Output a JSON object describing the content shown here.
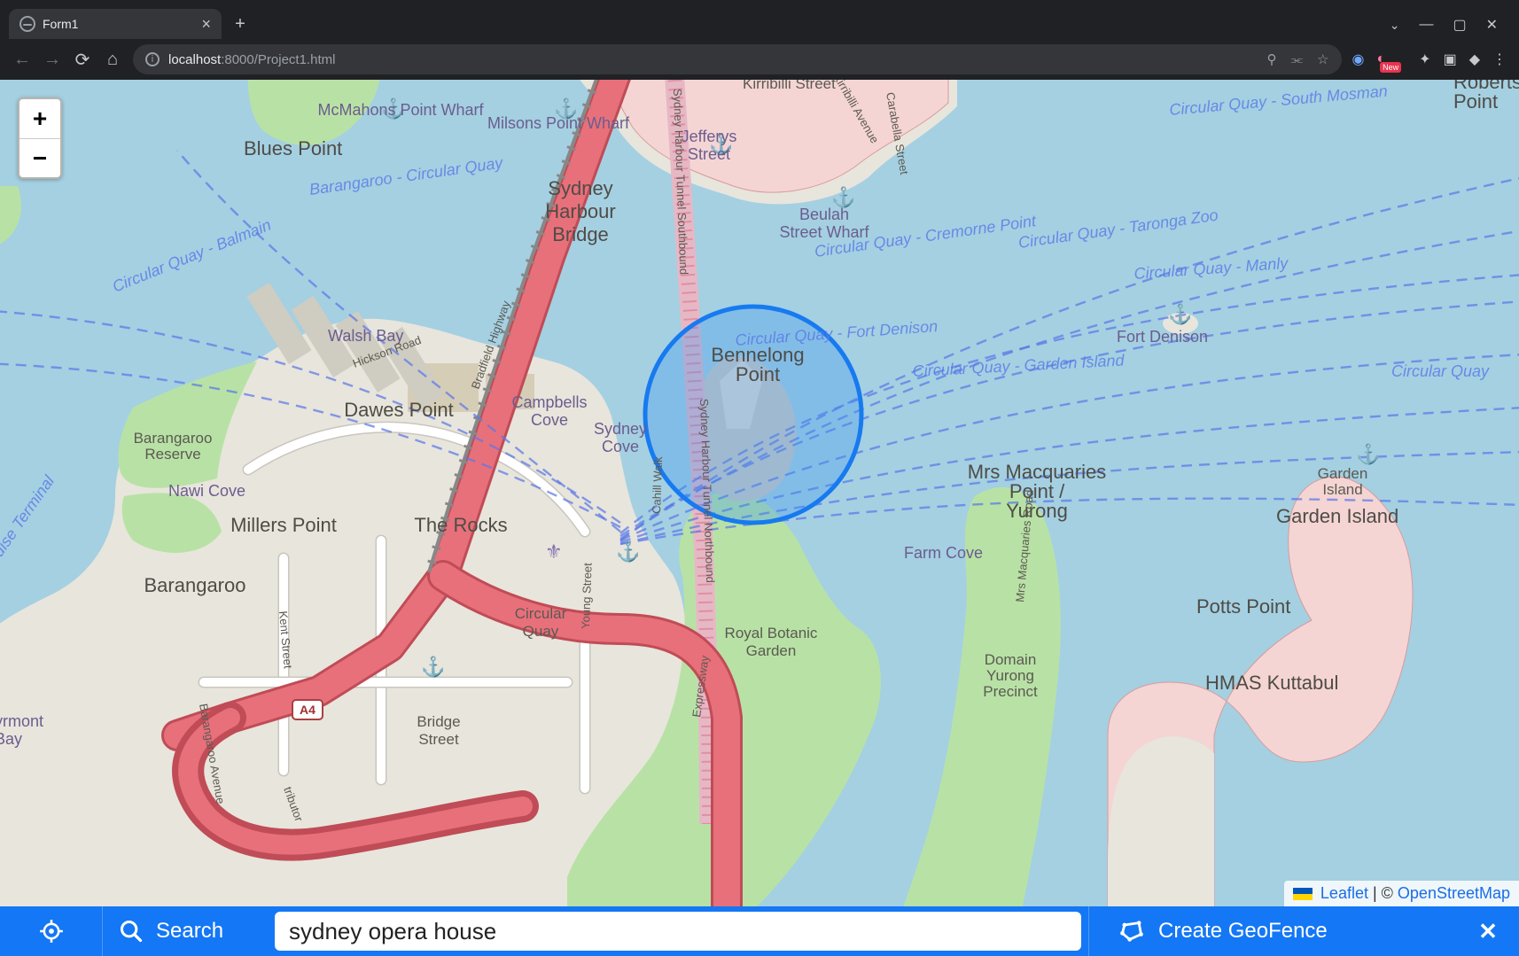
{
  "browser": {
    "tab_title": "Form1",
    "url_host": "localhost",
    "url_path": ":8000/Project1.html",
    "ext_badge": "New"
  },
  "map": {
    "zoom_in": "+",
    "zoom_out": "−",
    "attribution": {
      "leaflet": "Leaflet",
      "sep": " | © ",
      "osm": "OpenStreetMap"
    },
    "places": {
      "blues_point": "Blues Point",
      "mcmahons": "McMahons Point Wharf",
      "milsons": "Milsons Point Wharf",
      "harbour_bridge": "Sydney Harbour Bridge",
      "kirribilli_st": "Kirribilli Street",
      "kirribilli_ave": "Kirribilli Avenue",
      "carabella": "Carabella Street",
      "jefferys": "Jefferys Street",
      "beulah": "Beulah Street Wharf",
      "dawes": "Dawes Point",
      "campbells": "Campbells Cove",
      "sydney_cove": "Sydney Cove",
      "bennelong": "Bennelong Point",
      "the_rocks": "The Rocks",
      "millers": "Millers Point",
      "barangaroo": "Barangaroo",
      "barangaroo_res": "Barangaroo Reserve",
      "walsh_bay": "Walsh Bay",
      "nawi_cove": "Nawi Cove",
      "circular_quay": "Circular Quay",
      "bridge_st": "Bridge Street",
      "farm_cove": "Farm Cove",
      "mrs_macq": "Mrs Macquaries Point / Yurong",
      "botanic": "Royal Botanic Garden",
      "domain": "Domain Yurong Precinct",
      "potts": "Potts Point",
      "garden_island": "Garden Island",
      "garden_island_lbl": "Garden Island",
      "kuttabul": "HMAS Kuttabul",
      "fort_denison": "Fort Denison",
      "roberts_pt": "Roberts Point",
      "pyrmont": "yrmont Bay",
      "cruise_term": "Cruise Terminal",
      "hickson": "Hickson Road",
      "bradfield": "Bradfield Highway",
      "kent": "Kent Street",
      "young": "Young Street",
      "cahill": "Cahill Walk",
      "expressway": "Expressway",
      "barangaroo_ave": "Barangaroo Avenue",
      "tunnel_s": "Sydney Harbour Tunnel Southbound",
      "tunnel_n": "Sydney Harbour Tunnel Northbound",
      "shield_a4": "A4",
      "tributor": "tributor",
      "macq_rd": "Mrs Macquaries Road"
    },
    "ferries": {
      "balmain": "Circular Quay - Balmain",
      "barangaroo": "Barangaroo - Circular Quay",
      "south_mosman": "Circular Quay - South Mosman",
      "taronga": "Circular Quay - Taronga Zoo",
      "cremorne": "Circular Quay - Cremorne Point",
      "manly": "Circular Quay - Manly",
      "garden": "Circular Quay - Garden Island",
      "fort_denison": "Circular Quay - Fort Denison",
      "cq_right": "Circular Quay"
    }
  },
  "toolbar": {
    "search_label": "Search",
    "search_value": "sydney opera house",
    "create_label": "Create GeoFence"
  }
}
